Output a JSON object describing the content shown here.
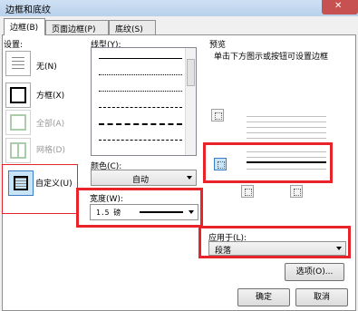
{
  "window": {
    "title": "边框和底纹"
  },
  "tabs": [
    {
      "label": "边框(B)"
    },
    {
      "label": "页面边框(P)"
    },
    {
      "label": "底纹(S)"
    }
  ],
  "settings": {
    "heading": "设置:",
    "items": [
      {
        "label": "无(N)"
      },
      {
        "label": "方框(X)"
      },
      {
        "label": "全部(A)"
      },
      {
        "label": "网格(D)"
      },
      {
        "label": "自定义(U)"
      }
    ]
  },
  "style": {
    "label": "线型(Y):"
  },
  "color": {
    "label": "颜色(C):",
    "value": "自动"
  },
  "width": {
    "label": "宽度(W):",
    "value": "1.5 磅"
  },
  "preview": {
    "heading": "预览",
    "hint": "单击下方图示或按钮可设置边框"
  },
  "apply": {
    "label": "应用于(L):",
    "value": "段落"
  },
  "buttons": {
    "options": "选项(O)...",
    "ok": "确定",
    "cancel": "取消"
  },
  "colors": {
    "highlight": "#e8232a",
    "selection": "#c9e4f7"
  }
}
